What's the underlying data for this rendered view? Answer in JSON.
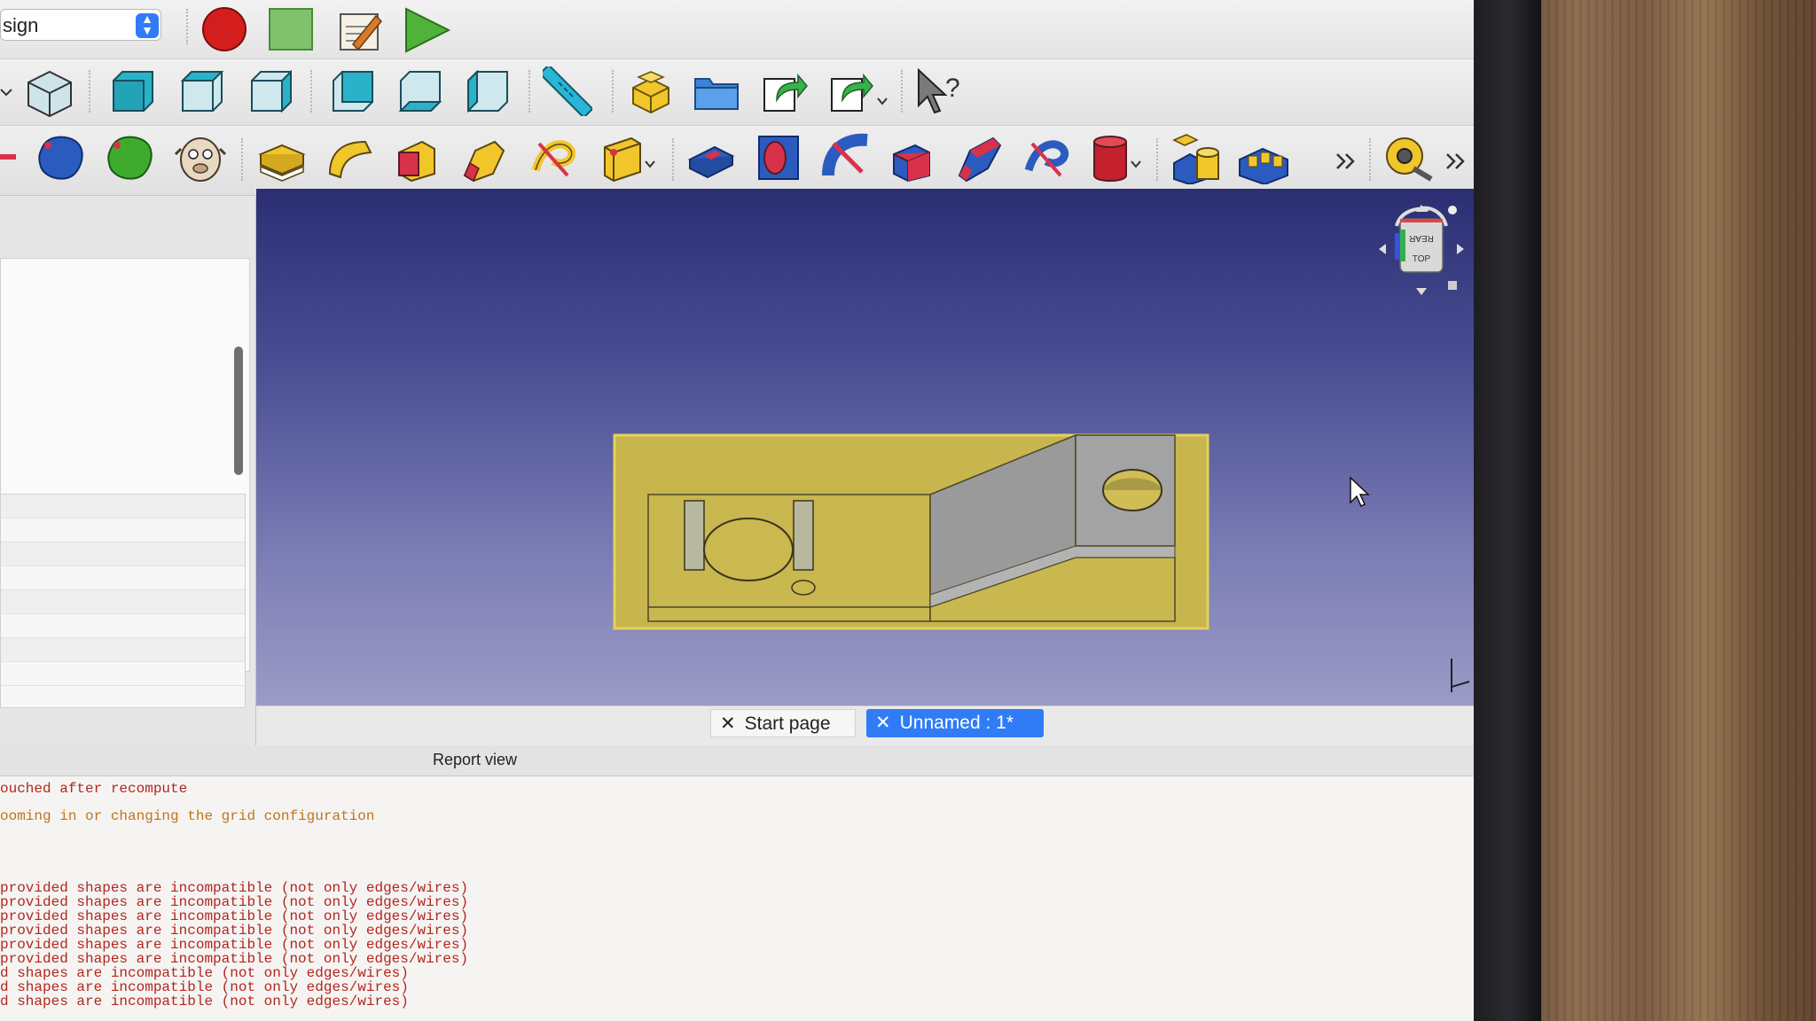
{
  "workbench": {
    "label": "sign"
  },
  "tabs": [
    {
      "label": "Start page",
      "active": false
    },
    {
      "label": "Unnamed : 1*",
      "active": true
    }
  ],
  "navcube": {
    "top_label": "TOP",
    "rear_label": "REAR"
  },
  "report": {
    "title": "Report view",
    "lines": [
      {
        "text": "ouched after recompute",
        "level": "error"
      },
      {
        "text": "ooming in or changing the grid configuration",
        "level": "warning"
      },
      {
        "text": "provided shapes are incompatible (not only edges/wires)",
        "level": "error"
      },
      {
        "text": "provided shapes are incompatible (not only edges/wires)",
        "level": "error"
      },
      {
        "text": "provided shapes are incompatible (not only edges/wires)",
        "level": "error"
      },
      {
        "text": "provided shapes are incompatible (not only edges/wires)",
        "level": "error"
      },
      {
        "text": "provided shapes are incompatible (not only edges/wires)",
        "level": "error"
      },
      {
        "text": "provided shapes are incompatible (not only edges/wires)",
        "level": "error"
      },
      {
        "text": "d shapes are incompatible (not only edges/wires)",
        "level": "error"
      },
      {
        "text": "d shapes are incompatible (not only edges/wires)",
        "level": "error"
      },
      {
        "text": "d shapes are incompatible (not only edges/wires)",
        "level": "error"
      }
    ]
  },
  "colors": {
    "accent": "#2f7cf6",
    "model_face": "#c8b54e",
    "error_text": "#b3261e",
    "warning_text": "#c0741a"
  },
  "toolbar_icons": {
    "row1": [
      "record-macro-icon",
      "stop-macro-icon",
      "macro-editor-icon",
      "run-macro-icon"
    ],
    "row2": [
      "isometric-view-icon",
      "front-view-icon",
      "top-view-icon",
      "right-view-icon",
      "rear-view-icon",
      "bottom-view-icon",
      "left-view-icon",
      "measure-distance-icon",
      "create-part-icon",
      "create-group-icon",
      "link-icon",
      "link-actions-icon",
      "whats-this-icon"
    ],
    "row3": [
      "body-icon",
      "sketch-icon",
      "attach-sketch-icon",
      "pad-icon",
      "revolve-icon",
      "loft-icon",
      "pipe-icon",
      "sweep-helix-icon",
      "datum-plane-icon",
      "pocket-icon",
      "hole-icon",
      "groove-icon",
      "subtractive-loft-icon",
      "subtractive-pipe-icon",
      "subtractive-helix-icon",
      "subtractive-cylinder-icon",
      "boolean-icon",
      "pattern-icon",
      "more-tools-icon",
      "measure-tape-icon",
      "overflow-icon"
    ]
  }
}
